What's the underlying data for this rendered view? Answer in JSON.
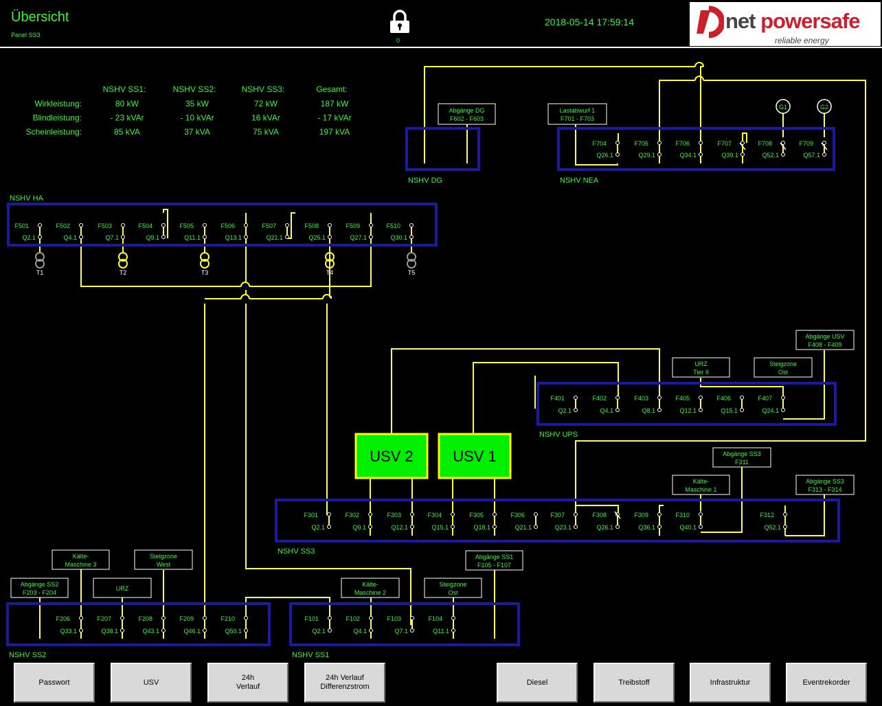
{
  "header": {
    "title": "Übersicht",
    "subtitle": "Panel SS3",
    "lock_count": "0",
    "datetime": "2018-05-14   17:59:14",
    "logo": {
      "net": "net",
      "brand": "powersafe",
      "tagline": "reliable energy"
    }
  },
  "power_table": {
    "columns": [
      "NSHV SS1:",
      "NSHV SS2:",
      "NSHV SS3:",
      "Gesamt:"
    ],
    "rows": [
      {
        "label": "Wirkleistung:",
        "values": [
          "80 kW",
          "35 kW",
          "72 kW",
          "187 kW"
        ]
      },
      {
        "label": "Blindleistung:",
        "values": [
          "- 23 kVAr",
          "- 10 kVAr",
          "16 kVAr",
          "- 17 kVAr"
        ]
      },
      {
        "label": "Scheinleistung:",
        "values": [
          "85 kVA",
          "37 kVA",
          "75 kVA",
          "197 kVA"
        ]
      }
    ]
  },
  "panels": {
    "ha": {
      "name": "NSHV HA",
      "f": [
        "F501",
        "F502",
        "F503",
        "F504",
        "F505",
        "F506",
        "F507",
        "F508",
        "F509",
        "F510"
      ],
      "q": [
        "Q2.1",
        "Q4.1",
        "Q7.1",
        "Q9.1",
        "Q11.1",
        "Q13.1",
        "Q21.1",
        "Q25.1",
        "Q27.1",
        "Q30.1"
      ],
      "transformers": [
        "T1",
        "T2",
        "T3",
        "T4",
        "T5"
      ]
    },
    "dg": {
      "name": "NSHV DG"
    },
    "nea": {
      "name": "NSHV NEA",
      "f": [
        "F704",
        "F705",
        "F706",
        "F707",
        "F708",
        "F709"
      ],
      "q": [
        "Q26.1",
        "Q29.1",
        "Q34.1",
        "Q39.1",
        "Q52.1",
        "Q57.1"
      ],
      "generators": [
        "G1",
        "G2"
      ]
    },
    "ups": {
      "name": "NSHV UPS",
      "f": [
        "F401",
        "F402",
        "F403",
        "F405",
        "F406",
        "F407"
      ],
      "q": [
        "Q2.1",
        "Q4.1",
        "Q8.1",
        "Q12.1",
        "Q15.1",
        "Q24.1"
      ]
    },
    "ss3": {
      "name": "NSHV SS3",
      "f": [
        "F301",
        "F302",
        "F303",
        "F304",
        "F305",
        "F306",
        "F307",
        "F308",
        "F309",
        "F310",
        "F312"
      ],
      "q": [
        "Q2.1",
        "Q9.1",
        "Q12.1",
        "Q15.1",
        "Q18.1",
        "Q21.1",
        "Q23.1",
        "Q26.1",
        "Q36.1",
        "Q40.1",
        "Q52.1"
      ]
    },
    "ss2": {
      "name": "NSHV SS2",
      "f": [
        "F206",
        "F207",
        "F208",
        "F209",
        "F210"
      ],
      "q": [
        "Q33.1",
        "Q38.1",
        "Q43.1",
        "Q46.1",
        "Q50.1"
      ]
    },
    "ss1": {
      "name": "NSHV SS1",
      "f": [
        "F101",
        "F102",
        "F103",
        "F104"
      ],
      "q": [
        "Q2.1",
        "Q4.1",
        "Q7.1",
        "Q11.1"
      ]
    }
  },
  "ups_units": [
    "USV 2",
    "USV 1"
  ],
  "labels": {
    "abg_dg": [
      "Abgänge DG",
      "F602 - F603"
    ],
    "lastabwurf": [
      "Lastabwurf 1",
      "F701 - F703"
    ],
    "abg_usv": [
      "Abgänge USV",
      "F408 - F409"
    ],
    "urz_tier": [
      "URZ",
      "Tier II"
    ],
    "steig_ost_ups": [
      "Steigzone",
      "Ost"
    ],
    "abg_ss3_f311": [
      "Abgänge SS3",
      "F311"
    ],
    "kaelte_m1": [
      "Kälte-",
      "Maschine 1"
    ],
    "abg_ss3_f313": [
      "Abgänge SS3",
      "F313 - F314"
    ],
    "kaelte_m3": [
      "Kälte-",
      "Maschine 3"
    ],
    "steig_west": [
      "Steigzone",
      "West"
    ],
    "abg_ss2": [
      "Abgänge SS2",
      "F203 - F204"
    ],
    "urz": [
      "URZ"
    ],
    "kaelte_m2": [
      "Kälte-",
      "Maschine 2"
    ],
    "steig_ost_ss1": [
      "Steigzone",
      "Ost"
    ],
    "abg_ss1": [
      "Abgänge SS1",
      "F105 - F107"
    ]
  },
  "buttons": {
    "passwort": "Passwort",
    "usv": "USV",
    "verlauf24": "24h\nVerlauf",
    "diff24": "24h Verlauf\nDifferenzstrom",
    "diesel": "Diesel",
    "treibstoff": "Treibstoff",
    "infrastruktur": "Infrastruktur",
    "eventrekorder": "Eventrekorder"
  },
  "colors": {
    "line": "#ffff33",
    "panel_border": "#1a1aa0",
    "text": "#3df53d",
    "usv_fill": "#00ee00",
    "usv_border": "#ffff00"
  },
  "icons": [
    "lock-icon",
    "generator-icon",
    "transformer-icon",
    "breaker-icon",
    "brand-logo-icon"
  ]
}
